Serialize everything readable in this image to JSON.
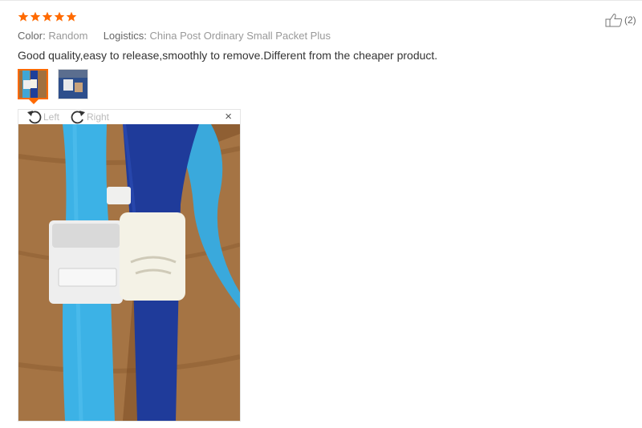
{
  "review": {
    "rating": 5,
    "rating_max": 5,
    "star_color": "#ff6a00",
    "color_label": "Color:",
    "color_value": "Random",
    "logistics_label": "Logistics:",
    "logistics_value": "China Post Ordinary Small Packet Plus",
    "text": "Good quality,easy to release,smoothly to remove.Different from the cheaper product.",
    "helpful_count": "(2)"
  },
  "gallery": {
    "thumbnails": [
      {
        "icon": "photo-thumbnail",
        "selected": true
      },
      {
        "icon": "photo-thumbnail",
        "selected": false
      }
    ],
    "accent": "#ff6a00"
  },
  "viewer": {
    "rotate_left_label": "Left",
    "rotate_right_label": "Right",
    "close_glyph": "×"
  }
}
